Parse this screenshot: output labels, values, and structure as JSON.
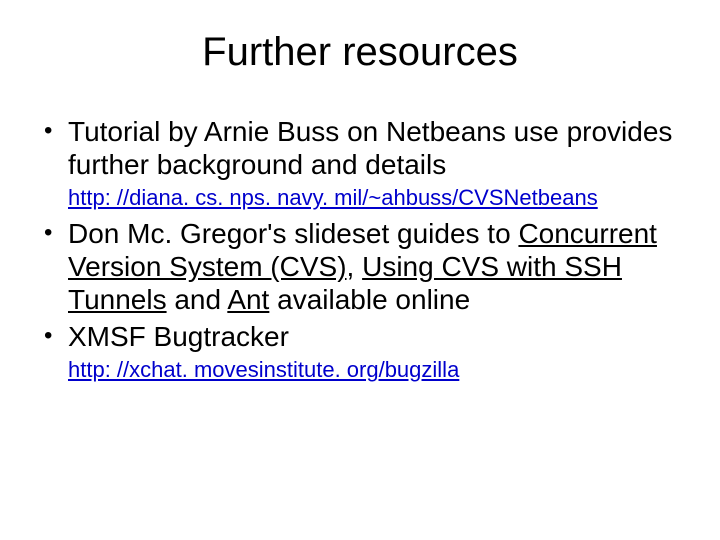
{
  "title": "Further resources",
  "bullets": {
    "b1": {
      "text": "Tutorial by Arnie Buss on Netbeans use provides further background and details",
      "link": "http: //diana. cs. nps. navy. mil/~ahbuss/CVSNetbeans"
    },
    "b2": {
      "prefix": "Don Mc. Gregor's slideset guides to ",
      "link1": "Concurrent Version System (CVS)",
      "sep1": ", ",
      "link2": "Using CVS with SSH Tunnels",
      "mid": " and ",
      "link3": "Ant",
      "suffix": " available online"
    },
    "b3": {
      "text": "XMSF Bugtracker",
      "link": "http: //xchat. movesinstitute. org/bugzilla"
    }
  }
}
